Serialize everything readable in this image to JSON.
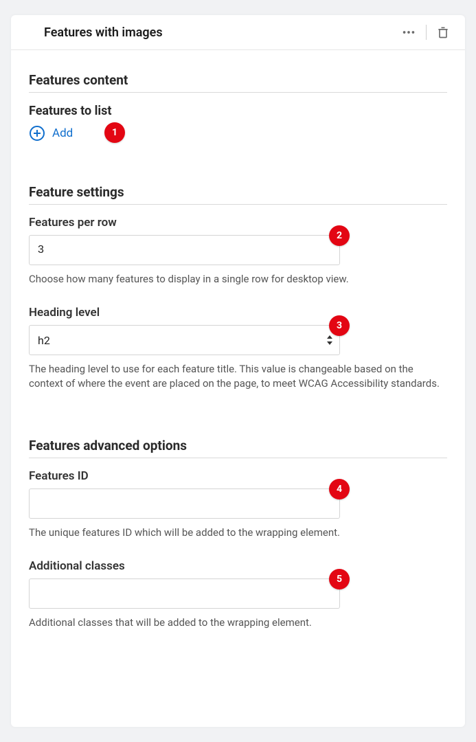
{
  "panel": {
    "title": "Features with images"
  },
  "section_content": {
    "title": "Features content"
  },
  "features_list": {
    "heading": "Features to list",
    "add_label": "Add"
  },
  "section_settings": {
    "title": "Feature settings"
  },
  "features_per_row": {
    "label": "Features per row",
    "value": "3",
    "help": "Choose how many features to display in a single row for desktop view."
  },
  "heading_level": {
    "label": "Heading level",
    "value": "h2",
    "help": "The heading level to use for each feature title. This value is changeable based on the context of where the event are placed on the page, to meet WCAG Accessibility standards."
  },
  "section_advanced": {
    "title": "Features advanced options"
  },
  "features_id": {
    "label": "Features ID",
    "value": "",
    "help": "The unique features ID which will be added to the wrapping element."
  },
  "additional_classes": {
    "label": "Additional classes",
    "value": "",
    "help": "Additional classes that will be added to the wrapping element."
  },
  "annotations": {
    "b1": "1",
    "b2": "2",
    "b3": "3",
    "b4": "4",
    "b5": "5"
  }
}
